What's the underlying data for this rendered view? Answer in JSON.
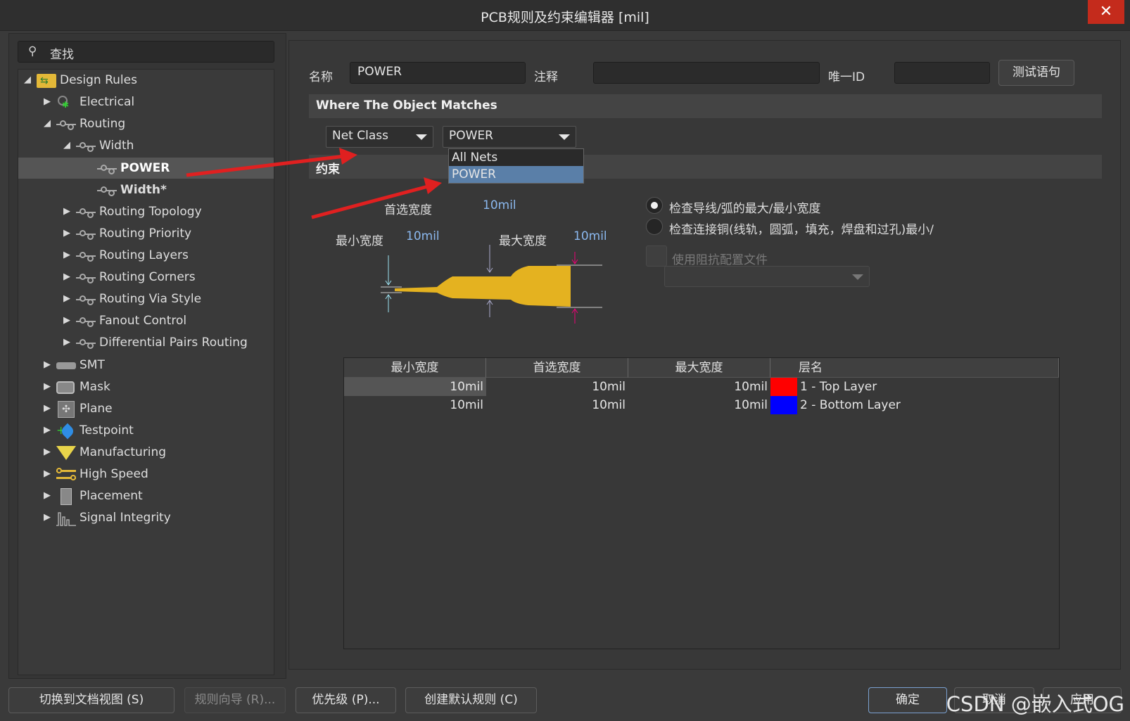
{
  "window": {
    "title": "PCB规则及约束编辑器 [mil]",
    "close": "✕"
  },
  "search": {
    "placeholder": "查找"
  },
  "tree": [
    {
      "label": "Design Rules",
      "icon": "design-rules-icon",
      "expanded": true
    },
    {
      "label": "Electrical",
      "icon": "electrical-icon"
    },
    {
      "label": "Routing",
      "icon": "routing-icon",
      "expanded": true
    },
    {
      "label": "Width",
      "icon": "routing-icon",
      "expanded": true
    },
    {
      "label": "POWER",
      "icon": "routing-icon",
      "selected": true
    },
    {
      "label": "Width*",
      "icon": "routing-icon"
    },
    {
      "label": "Routing Topology",
      "icon": "routing-icon"
    },
    {
      "label": "Routing Priority",
      "icon": "routing-icon"
    },
    {
      "label": "Routing Layers",
      "icon": "routing-icon"
    },
    {
      "label": "Routing Corners",
      "icon": "routing-icon"
    },
    {
      "label": "Routing Via Style",
      "icon": "routing-icon"
    },
    {
      "label": "Fanout Control",
      "icon": "routing-icon"
    },
    {
      "label": "Differential Pairs Routing",
      "icon": "routing-icon"
    },
    {
      "label": "SMT",
      "icon": "smt-icon"
    },
    {
      "label": "Mask",
      "icon": "mask-icon"
    },
    {
      "label": "Plane",
      "icon": "plane-icon"
    },
    {
      "label": "Testpoint",
      "icon": "testpoint-icon"
    },
    {
      "label": "Manufacturing",
      "icon": "manufacturing-icon"
    },
    {
      "label": "High Speed",
      "icon": "high-speed-icon"
    },
    {
      "label": "Placement",
      "icon": "placement-icon"
    },
    {
      "label": "Signal Integrity",
      "icon": "signal-integrity-icon"
    }
  ],
  "rule": {
    "name_label": "名称",
    "name_value": "POWER",
    "comment_label": "注释",
    "comment_value": "",
    "uid_label": "唯一ID",
    "uid_value": "",
    "test_button": "测试语句"
  },
  "where": {
    "title": "Where The Object Matches",
    "type_value": "Net Class",
    "net_value": "POWER",
    "dropdown_options": [
      "All Nets",
      "POWER"
    ],
    "dropdown_selected": "POWER"
  },
  "constraints": {
    "title": "约束",
    "preferred_label": "首选宽度",
    "preferred_value": "10mil",
    "min_label": "最小宽度",
    "min_value": "10mil",
    "max_label": "最大宽度",
    "max_value": "10mil",
    "radio1": "检查导线/弧的最大/最小宽度",
    "radio2": "检查连接铜(线轨，圆弧，填充，焊盘和过孔)最小/",
    "impedance_label": "使用阻抗配置文件"
  },
  "table": {
    "headers": [
      "最小宽度",
      "首选宽度",
      "最大宽度",
      "层名"
    ],
    "rows": [
      {
        "min": "10mil",
        "pref": "10mil",
        "max": "10mil",
        "color": "#ff0000",
        "layer": "1 - Top Layer"
      },
      {
        "min": "10mil",
        "pref": "10mil",
        "max": "10mil",
        "color": "#0000ff",
        "layer": "2 - Bottom Layer"
      }
    ]
  },
  "footer": {
    "doc_view": "切换到文档视图 (S)",
    "wizard": "规则向导 (R)...",
    "priority": "优先级 (P)...",
    "create_default": "创建默认规则 (C)",
    "ok": "确定",
    "cancel": "取消",
    "apply": "应用"
  },
  "watermark": "CSDN @嵌入式OG"
}
